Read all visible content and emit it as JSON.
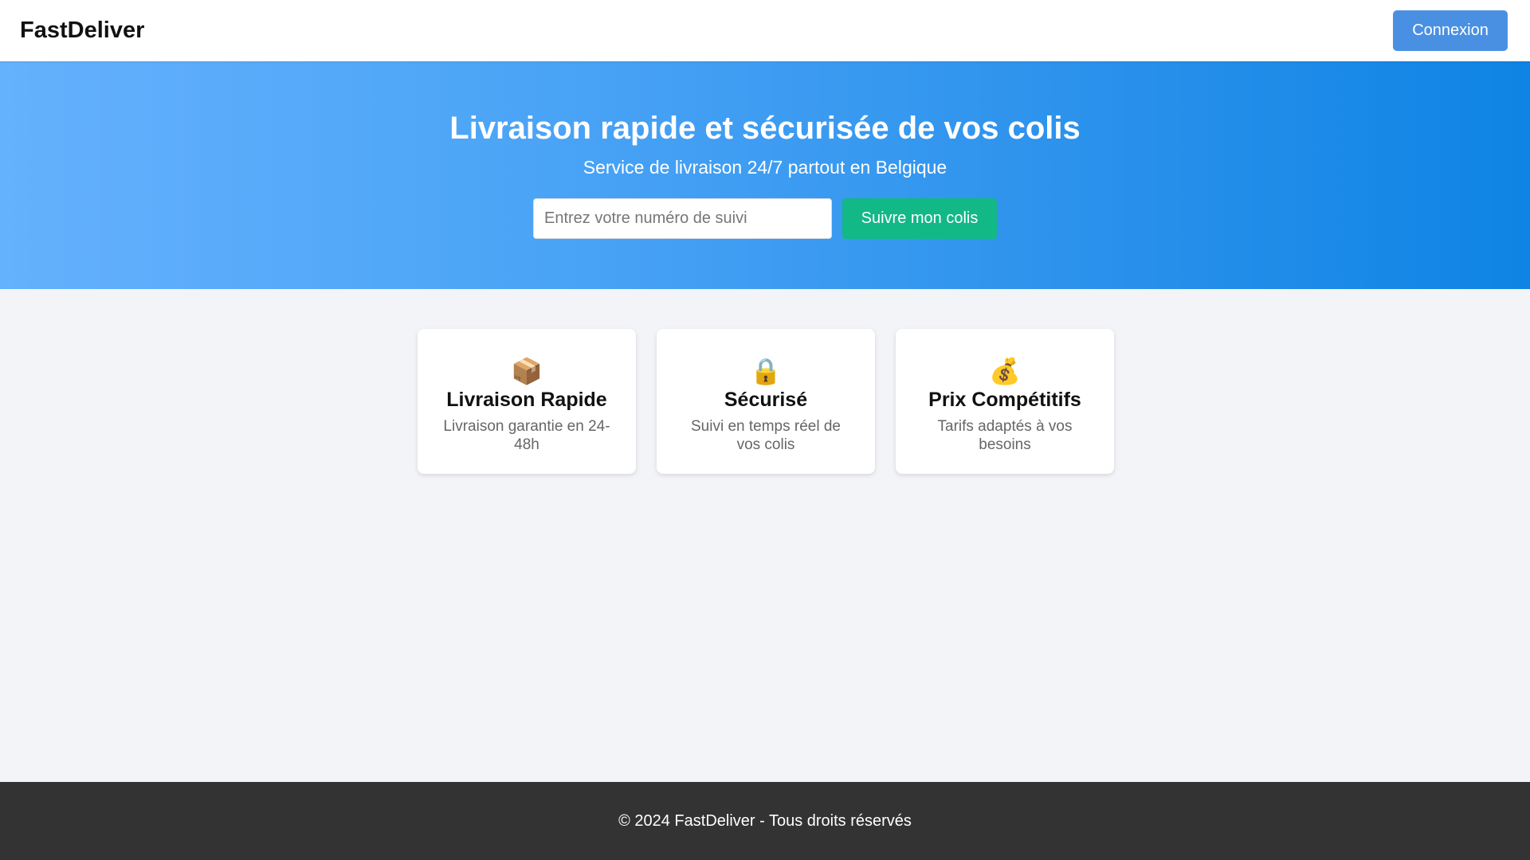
{
  "header": {
    "logo": "FastDeliver",
    "login_label": "Connexion"
  },
  "hero": {
    "title": "Livraison rapide et sécurisée de vos colis",
    "subtitle": "Service de livraison 24/7 partout en Belgique",
    "tracking_placeholder": "Entrez votre numéro de suivi",
    "tracking_value": "",
    "track_button_label": "Suivre mon colis"
  },
  "features": [
    {
      "icon": "📦",
      "icon_name": "package-icon",
      "title": "Livraison Rapide",
      "description": "Livraison garantie en 24-48h"
    },
    {
      "icon": "🔒",
      "icon_name": "lock-icon",
      "title": "Sécurisé",
      "description": "Suivi en temps réel de vos colis"
    },
    {
      "icon": "💰",
      "icon_name": "money-bag-icon",
      "title": "Prix Compétitifs",
      "description": "Tarifs adaptés à vos besoins"
    }
  ],
  "footer": {
    "text": "© 2024 FastDeliver - Tous droits réservés"
  },
  "colors": {
    "primary_button": "#4a90e2",
    "track_button": "#12b886",
    "hero_gradient_start": "#64b1fd",
    "hero_gradient_end": "#0f84e4",
    "footer_bg": "#333333",
    "page_bg": "#f3f4f8"
  }
}
